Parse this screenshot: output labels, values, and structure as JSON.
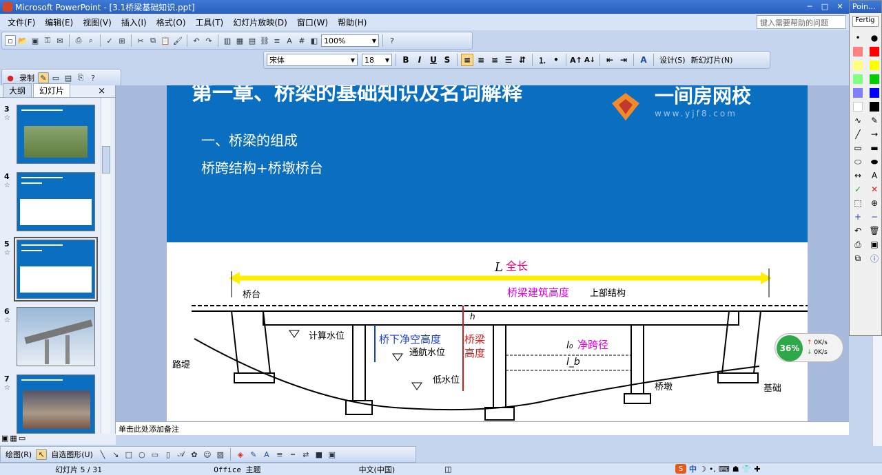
{
  "window": {
    "title": "Microsoft PowerPoint - [3.1桥梁基础知识.ppt]",
    "controls": [
      "─",
      "□",
      "✕"
    ]
  },
  "menu": {
    "items": [
      "文件(F)",
      "编辑(E)",
      "视图(V)",
      "插入(I)",
      "格式(O)",
      "工具(T)",
      "幻灯片放映(D)",
      "窗口(W)",
      "帮助(H)"
    ],
    "help_placeholder": "键入需要帮助的问题"
  },
  "standard_toolbar": {
    "zoom": "100%"
  },
  "format_toolbar": {
    "font": "宋体",
    "size": "18",
    "bold": "B",
    "italic": "I",
    "underline": "U",
    "shadow": "S",
    "design_label": "设计(S)",
    "new_slide_label": "新幻灯片(N)"
  },
  "record_toolbar": {
    "record_label": "录制"
  },
  "outline_pane": {
    "tab_outline": "大纲",
    "tab_slides": "幻灯片",
    "close": "×",
    "thumbnails": [
      {
        "num": "3",
        "star": "☆"
      },
      {
        "num": "4",
        "star": "☆"
      },
      {
        "num": "5",
        "star": "☆",
        "selected": true
      },
      {
        "num": "6",
        "star": "☆"
      },
      {
        "num": "7",
        "star": "☆"
      }
    ]
  },
  "slide": {
    "title": "第一章、桥梁的基础知识及名词解释",
    "brand": "一间房网校",
    "brand_url": "www.yjf8.com",
    "line1": "一、桥梁的组成",
    "line2": "桥跨结构+桥墩桥台",
    "diagram_labels": {
      "length": "全长",
      "L": "L",
      "build_height": "桥梁建筑高度",
      "superstructure": "上部结构",
      "abutment": "桥台",
      "embankment": "路堤",
      "design_level": "计算水位",
      "clearance": "桥下净空高度",
      "nav_level": "通航水位",
      "low_level": "低水位",
      "bridge_height_1": "桥梁",
      "bridge_height_2": "高度",
      "net_span": "净跨径",
      "l0": "l₀",
      "lb": "l_b",
      "pier": "桥墩",
      "foundation": "基础",
      "h": "h"
    }
  },
  "notes": {
    "placeholder": "单击此处添加备注"
  },
  "drawing_toolbar": {
    "draw_label": "绘图(R)",
    "autoshapes_label": "自选图形(U)"
  },
  "status": {
    "slide_info": "幻灯片 5 / 31",
    "theme": "Office 主题",
    "language": "中文(中国)"
  },
  "pointer_panel": {
    "title": "Poin...",
    "mode": "Fertig",
    "colors": [
      "#ff8080",
      "#ff0000",
      "#ffff80",
      "#ffff00",
      "#80ff80",
      "#00cc00",
      "#8080ff",
      "#0000ff",
      "#ffffff",
      "#000000"
    ]
  },
  "network_widget": {
    "percent": "36%",
    "up": "0K/s",
    "down": "0K/s"
  }
}
